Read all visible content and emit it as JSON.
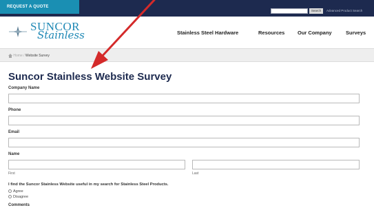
{
  "topbar": {
    "quote_button": "REQUEST A QUOTE",
    "search_placeholder": "",
    "search_button": "Search",
    "advanced_search": "Advanced Product Search"
  },
  "logo": {
    "line1": "SUNCOR",
    "line2": "Stainless"
  },
  "nav": {
    "items": [
      "Stainless Steel Hardware",
      "Resources",
      "Our Company",
      "Surveys"
    ]
  },
  "breadcrumb": {
    "home": "Home",
    "separator": " / ",
    "current": "Website Survey"
  },
  "form": {
    "title": "Suncor Stainless Website Survey",
    "company_label": "Company Name",
    "phone_label": "Phone",
    "email_label": "Email",
    "name_label": "Name",
    "first_label": "First",
    "last_label": "Last",
    "question": "I find the Suncor Stainless Website useful in my search for Stainless Steel Products.",
    "options": [
      "Agree",
      "Disagree"
    ],
    "comments_label": "Comments"
  },
  "colors": {
    "topbar_bg": "#1d2a4f",
    "quote_button_bg": "#1a8fb3",
    "logo_blue": "#1e88b5",
    "arrow_red": "#d42a2a",
    "title_navy": "#1d2a4f"
  }
}
